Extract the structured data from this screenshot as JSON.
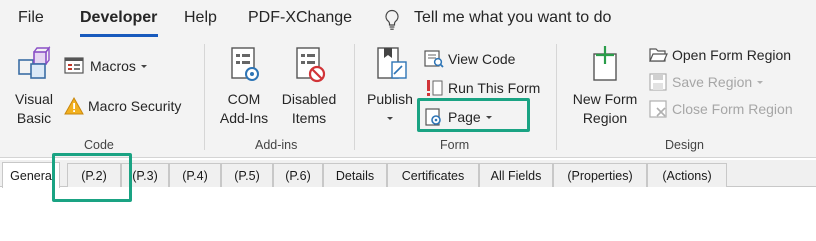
{
  "menubar": {
    "items": [
      "File",
      "Developer",
      "Help",
      "PDF-XChange"
    ],
    "tell_me": "Tell me what you want to do"
  },
  "ribbon": {
    "code": {
      "label": "Code",
      "visual_basic": [
        "Visual",
        "Basic"
      ],
      "macros": "Macros",
      "macro_security": "Macro Security"
    },
    "addins": {
      "label": "Add-ins",
      "com": [
        "COM",
        "Add-Ins"
      ],
      "disabled": [
        "Disabled",
        "Items"
      ]
    },
    "form": {
      "label": "Form",
      "publish": "Publish",
      "view_code": "View Code",
      "run_this_form": "Run This Form",
      "page": "Page"
    },
    "design": {
      "label": "Design",
      "new_form_region": [
        "New Form",
        "Region"
      ],
      "open_form_region": "Open Form Region",
      "save_region": "Save Region",
      "close_form_region": "Close Form Region"
    }
  },
  "tabs": [
    "Genera",
    "(P.2)",
    "(P.3)",
    "(P.4)",
    "(P.5)",
    "(P.6)",
    "Details",
    "Certificates",
    "All Fields",
    "(Properties)",
    "(Actions)"
  ],
  "colors": {
    "accent": "#185abd",
    "highlight": "#1aa383",
    "ribbon_bg": "#f3f3f3"
  }
}
